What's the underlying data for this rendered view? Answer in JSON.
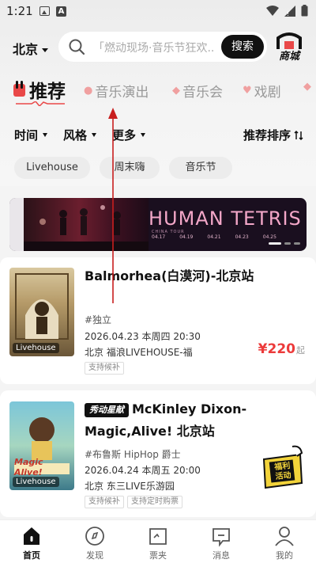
{
  "status_bar": {
    "time": "1:21"
  },
  "header": {
    "city": "北京",
    "search_placeholder": "「燃动现场·音乐节狂欢...",
    "search_button": "搜索",
    "mall_label": "商城"
  },
  "category_tabs": [
    {
      "label": "推荐",
      "active": true
    },
    {
      "label": "音乐演出",
      "active": false
    },
    {
      "label": "音乐会",
      "active": false
    },
    {
      "label": "戏剧",
      "active": false
    }
  ],
  "filters": {
    "time": "时间",
    "style": "风格",
    "more": "更多",
    "sort": "推荐排序"
  },
  "chips": [
    "Livehouse",
    "周末嗨",
    "音乐节"
  ],
  "banner": {
    "title": "HUMAN TETRIS",
    "subtitle": "CHINA    TOUR",
    "dates": [
      "04.17",
      "04.19",
      "04.21",
      "04.23",
      "04.25"
    ]
  },
  "events": [
    {
      "title": "Balmorhea(白漠河)-北京站",
      "genre": "#独立",
      "date": "2026.04.23 本周四 20:30",
      "venue": "北京 福浪LIVEHOUSE-福",
      "tags": [
        "支持候补"
      ],
      "price": "¥220",
      "price_suffix": "起",
      "poster_tag": "Livehouse"
    },
    {
      "brand": "秀动星献",
      "title": "McKinley Dixon-Magic,Alive! 北京站",
      "genre": "#布鲁斯 HipHop 爵士",
      "date": "2026.04.24 本周五 20:00",
      "venue": "北京 东三LIVE乐游园",
      "tags": [
        "支持候补",
        "支持定时购票"
      ],
      "poster_tag": "Livehouse",
      "poster_text": "Magic Alive!"
    }
  ],
  "float_badge": "福利活动",
  "bottom_nav": [
    {
      "label": "首页",
      "icon": "home-icon",
      "active": true
    },
    {
      "label": "发现",
      "icon": "compass-icon",
      "active": false
    },
    {
      "label": "票夹",
      "icon": "ticket-folder-icon",
      "active": false
    },
    {
      "label": "消息",
      "icon": "message-icon",
      "active": false
    },
    {
      "label": "我的",
      "icon": "profile-icon",
      "active": false
    }
  ],
  "colors": {
    "accent_red": "#ec3a3a",
    "primary": "#111111"
  }
}
